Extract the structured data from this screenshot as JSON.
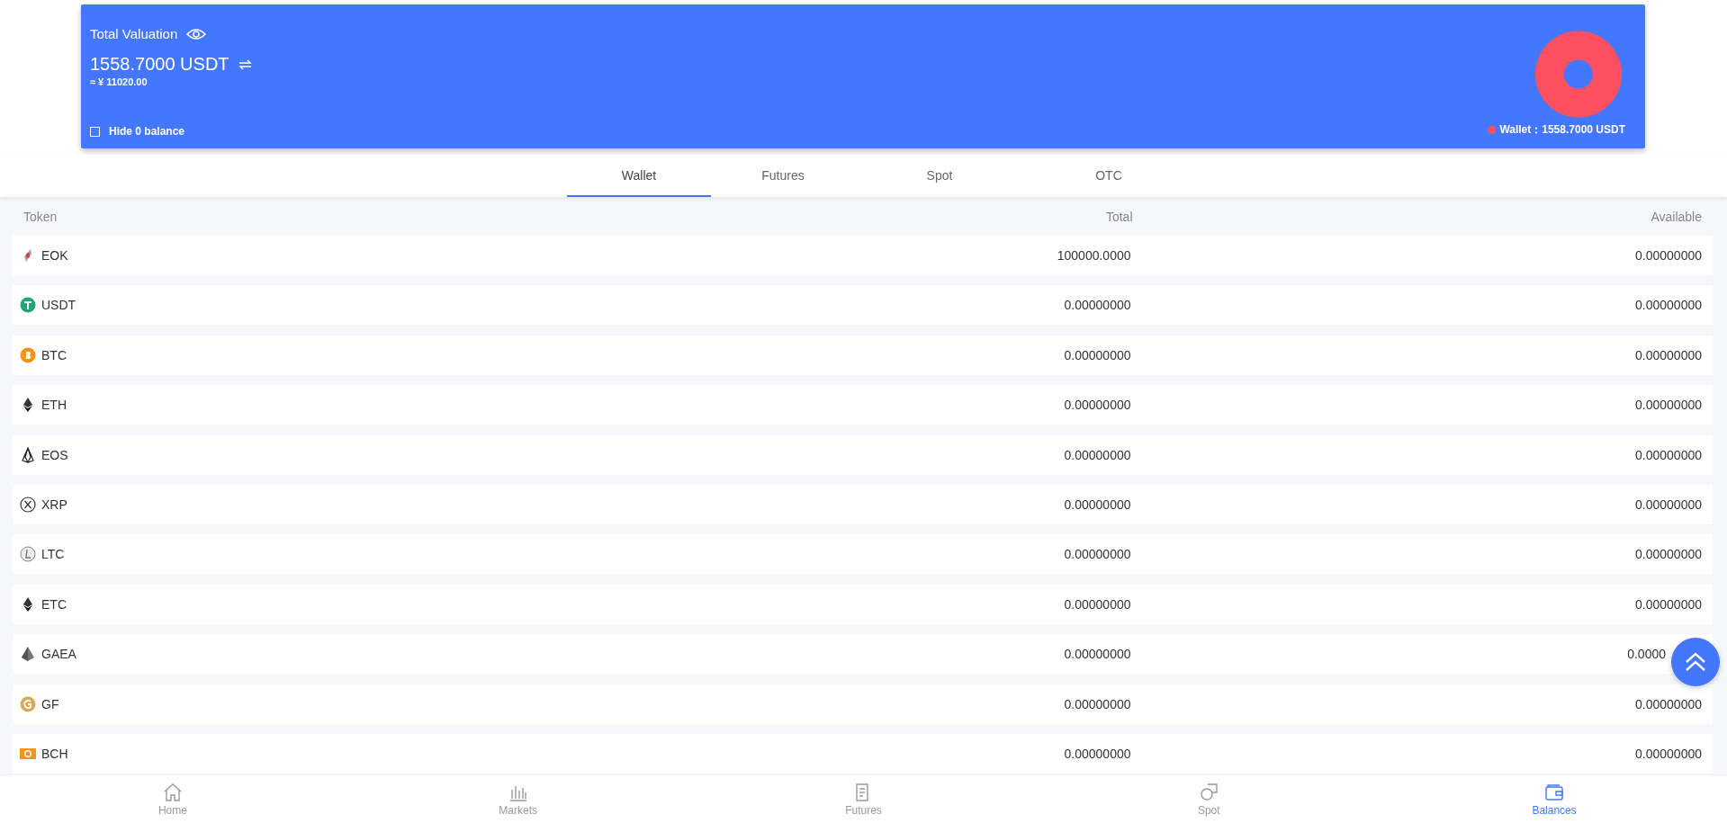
{
  "summary": {
    "title": "Total Valuation",
    "amount": "1558.7000 USDT",
    "fiat": "≈ ¥ 11020.00",
    "hide_zero": {
      "label": "Hide 0 balance",
      "checked": false
    },
    "legend": [
      {
        "label": "Wallet：1558.7000 USDT",
        "color": "#ff5062"
      }
    ]
  },
  "tabs": [
    {
      "label": "Wallet",
      "selected": true
    },
    {
      "label": "Futures",
      "selected": false
    },
    {
      "label": "Spot",
      "selected": false
    },
    {
      "label": "OTC",
      "selected": false
    }
  ],
  "table": {
    "columns": [
      "Token",
      "Total",
      "Available"
    ],
    "rows": [
      [
        "EOK",
        "100000.0000",
        "0.00000000"
      ],
      [
        "USDT",
        "0.00000000",
        "0.00000000"
      ],
      [
        "BTC",
        "0.00000000",
        "0.00000000"
      ],
      [
        "ETH",
        "0.00000000",
        "0.00000000"
      ],
      [
        "EOS",
        "0.00000000",
        "0.00000000"
      ],
      [
        "XRP",
        "0.00000000",
        "0.00000000"
      ],
      [
        "LTC",
        "0.00000000",
        "0.00000000"
      ],
      [
        "ETC",
        "0.00000000",
        "0.00000000"
      ],
      [
        "GAEA",
        "0.00000000",
        "0.0000"
      ],
      [
        "GF",
        "0.00000000",
        "0.00000000"
      ],
      [
        "BCH",
        "0.00000000",
        "0.00000000"
      ]
    ]
  },
  "nav": [
    {
      "label": "Home",
      "selected": false
    },
    {
      "label": "Markets",
      "selected": false
    },
    {
      "label": "Futures",
      "selected": false
    },
    {
      "label": "Spot",
      "selected": false
    },
    {
      "label": "Balances",
      "selected": true
    }
  ]
}
